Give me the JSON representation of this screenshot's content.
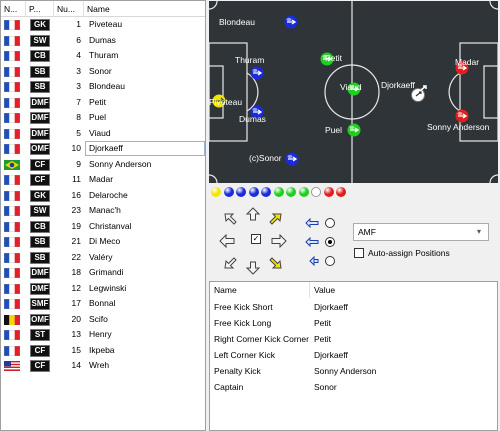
{
  "roster": {
    "columns": [
      "N...",
      "P...",
      "Nu...",
      "Name"
    ],
    "players": [
      {
        "flag": "fr",
        "pos": "GK",
        "num": "1",
        "name": "Piveteau"
      },
      {
        "flag": "fr",
        "pos": "SW",
        "num": "6",
        "name": "Dumas"
      },
      {
        "flag": "fr",
        "pos": "CB",
        "num": "4",
        "name": "Thuram"
      },
      {
        "flag": "fr",
        "pos": "SB",
        "num": "3",
        "name": "Sonor"
      },
      {
        "flag": "fr",
        "pos": "SB",
        "num": "3",
        "name": "Blondeau"
      },
      {
        "flag": "fr",
        "pos": "DMF",
        "num": "7",
        "name": "Petit"
      },
      {
        "flag": "fr",
        "pos": "DMF",
        "num": "8",
        "name": "Puel"
      },
      {
        "flag": "fr",
        "pos": "DMF",
        "num": "5",
        "name": "Viaud"
      },
      {
        "flag": "fr",
        "pos": "OMF",
        "num": "10",
        "name": "Djorkaeff"
      },
      {
        "flag": "br",
        "pos": "CF",
        "num": "9",
        "name": "Sonny Anderson"
      },
      {
        "flag": "fr",
        "pos": "CF",
        "num": "11",
        "name": "Madar"
      },
      {
        "flag": "fr",
        "pos": "GK",
        "num": "16",
        "name": "Delaroche"
      },
      {
        "flag": "fr",
        "pos": "SW",
        "num": "23",
        "name": "Manac'h"
      },
      {
        "flag": "fr",
        "pos": "CB",
        "num": "19",
        "name": "Christanval"
      },
      {
        "flag": "fr",
        "pos": "SB",
        "num": "21",
        "name": "Di Meco"
      },
      {
        "flag": "fr",
        "pos": "SB",
        "num": "22",
        "name": "Valéry"
      },
      {
        "flag": "fr",
        "pos": "DMF",
        "num": "18",
        "name": "Grimandi"
      },
      {
        "flag": "fr",
        "pos": "DMF",
        "num": "12",
        "name": "Legwinski"
      },
      {
        "flag": "fr",
        "pos": "SMF",
        "num": "17",
        "name": "Bonnal"
      },
      {
        "flag": "be",
        "pos": "OMF",
        "num": "20",
        "name": "Scifo"
      },
      {
        "flag": "fr",
        "pos": "ST",
        "num": "13",
        "name": "Henry"
      },
      {
        "flag": "fr",
        "pos": "CF",
        "num": "15",
        "name": "Ikpeba"
      },
      {
        "flag": "us",
        "pos": "CF",
        "num": "14",
        "name": "Wreh"
      }
    ],
    "selected_index": 8
  },
  "pitch": {
    "players": [
      {
        "name": "Blondeau",
        "kind": "blue"
      },
      {
        "name": "Thuram",
        "kind": "blue"
      },
      {
        "name": "Piveteau",
        "kind": "gk"
      },
      {
        "name": "Dumas",
        "kind": "blue"
      },
      {
        "name": "Petit",
        "kind": "green"
      },
      {
        "name": "Viaud",
        "kind": "green"
      },
      {
        "name": "Puel",
        "kind": "green"
      },
      {
        "name": "(c)Sonor",
        "kind": "blue"
      },
      {
        "name": "Djorkaeff",
        "kind": "white"
      },
      {
        "name": "Madar",
        "kind": "red"
      },
      {
        "name": "Sonny Anderson",
        "kind": "red"
      }
    ]
  },
  "formation_balls": [
    "yellow",
    "blue",
    "blue",
    "blue",
    "blue",
    "green",
    "green",
    "green",
    "white",
    "red",
    "red"
  ],
  "controls": {
    "position_select": "AMF",
    "auto_assign_label": "Auto-assign Positions"
  },
  "properties": {
    "columns": [
      "Name",
      "Value"
    ],
    "rows": [
      {
        "name": "Free Kick Short",
        "value": "Djorkaeff"
      },
      {
        "name": "Free Kick Long",
        "value": "Petit"
      },
      {
        "name": "Right Corner Kick Corner",
        "value": "Petit"
      },
      {
        "name": "Left Corner Kick",
        "value": "Djorkaeff"
      },
      {
        "name": "Penalty Kick",
        "value": "Sonny Anderson"
      },
      {
        "name": "Captain",
        "value": "Sonor"
      }
    ]
  },
  "colors": {
    "pitch": "#2f3438",
    "ball_yellow": "#f5e400",
    "ball_blue": "#1a2bd8",
    "ball_green": "#1fcf1f",
    "ball_white": "#ffffff",
    "ball_red": "#e01e1e"
  }
}
